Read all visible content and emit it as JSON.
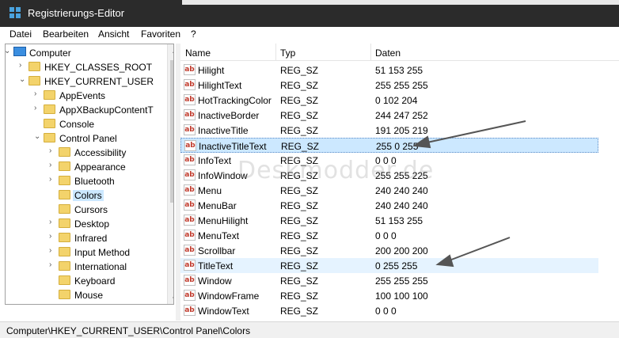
{
  "window": {
    "title": "Registrierungs-Editor"
  },
  "menu": [
    "Datei",
    "Bearbeiten",
    "Ansicht",
    "Favoriten",
    "?"
  ],
  "tree": [
    {
      "label": "Computer",
      "icon": "computer-icon",
      "arrow": "expanded"
    },
    {
      "label": "HKEY_CLASSES_ROOT",
      "arrow": "collapsed"
    },
    {
      "label": "HKEY_CURRENT_USER",
      "arrow": "expanded"
    },
    {
      "label": "AppEvents",
      "arrow": "collapsed"
    },
    {
      "label": "AppXBackupContentT",
      "arrow": "collapsed"
    },
    {
      "label": "Console",
      "arrow": "none"
    },
    {
      "label": "Control Panel",
      "arrow": "expanded"
    },
    {
      "label": "Accessibility",
      "arrow": "collapsed"
    },
    {
      "label": "Appearance",
      "arrow": "collapsed"
    },
    {
      "label": "Bluetooth",
      "arrow": "collapsed"
    },
    {
      "label": "Colors",
      "arrow": "none",
      "selected": true
    },
    {
      "label": "Cursors",
      "arrow": "none"
    },
    {
      "label": "Desktop",
      "arrow": "collapsed"
    },
    {
      "label": "Infrared",
      "arrow": "collapsed"
    },
    {
      "label": "Input Method",
      "arrow": "collapsed"
    },
    {
      "label": "International",
      "arrow": "collapsed"
    },
    {
      "label": "Keyboard",
      "arrow": "none"
    },
    {
      "label": "Mouse",
      "arrow": "none"
    }
  ],
  "list": {
    "columns": {
      "name": "Name",
      "type": "Typ",
      "data": "Daten"
    },
    "icon_text": "ab",
    "rows": [
      {
        "name": "Hilight",
        "type": "REG_SZ",
        "data": "51 153 255"
      },
      {
        "name": "HilightText",
        "type": "REG_SZ",
        "data": "255 255 255"
      },
      {
        "name": "HotTrackingColor",
        "type": "REG_SZ",
        "data": "0 102 204"
      },
      {
        "name": "InactiveBorder",
        "type": "REG_SZ",
        "data": "244 247 252"
      },
      {
        "name": "InactiveTitle",
        "type": "REG_SZ",
        "data": "191 205 219"
      },
      {
        "name": "InactiveTitleText",
        "type": "REG_SZ",
        "data": "255 0 255",
        "state": "selected"
      },
      {
        "name": "InfoText",
        "type": "REG_SZ",
        "data": "0 0 0"
      },
      {
        "name": "InfoWindow",
        "type": "REG_SZ",
        "data": "255 255 225"
      },
      {
        "name": "Menu",
        "type": "REG_SZ",
        "data": "240 240 240"
      },
      {
        "name": "MenuBar",
        "type": "REG_SZ",
        "data": "240 240 240"
      },
      {
        "name": "MenuHilight",
        "type": "REG_SZ",
        "data": "51 153 255"
      },
      {
        "name": "MenuText",
        "type": "REG_SZ",
        "data": "0 0 0"
      },
      {
        "name": "Scrollbar",
        "type": "REG_SZ",
        "data": "200 200 200"
      },
      {
        "name": "TitleText",
        "type": "REG_SZ",
        "data": "0 255 255",
        "state": "hover"
      },
      {
        "name": "Window",
        "type": "REG_SZ",
        "data": "255 255 255"
      },
      {
        "name": "WindowFrame",
        "type": "REG_SZ",
        "data": "100 100 100"
      },
      {
        "name": "WindowText",
        "type": "REG_SZ",
        "data": "0 0 0"
      }
    ]
  },
  "watermark": "Deskmodder.de",
  "status": {
    "path": "Computer\\HKEY_CURRENT_USER\\Control Panel\\Colors"
  },
  "colors": {
    "titlebar": "#2b2b2b",
    "selection": "#cce8ff",
    "hover": "#e5f3ff",
    "folder": "#f3d36b",
    "accent": "#3a8ee0"
  }
}
